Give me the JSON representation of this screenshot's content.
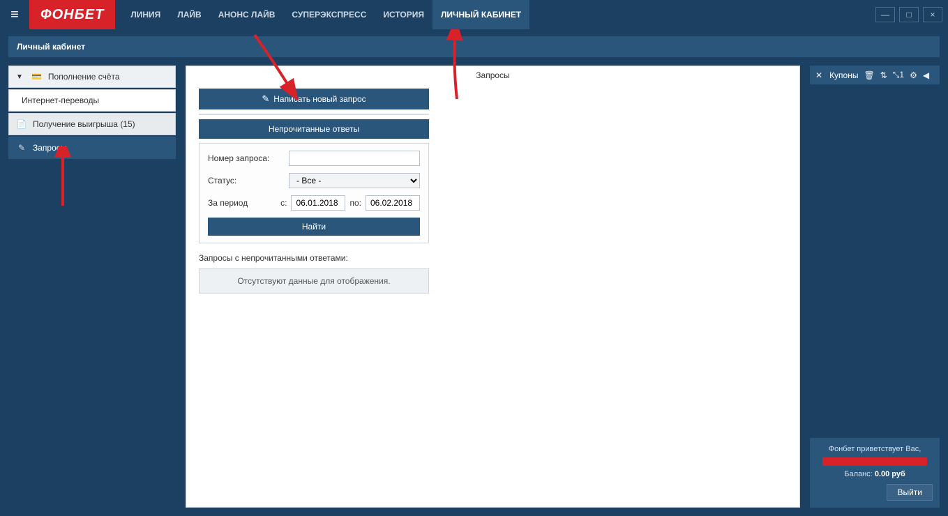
{
  "brand": "ФОНБЕТ",
  "nav": {
    "items": [
      {
        "label": "ЛИНИЯ"
      },
      {
        "label": "ЛАЙВ"
      },
      {
        "label": "АНОНС ЛАЙВ"
      },
      {
        "label": "СУПЕРЭКСПРЕСС"
      },
      {
        "label": "ИСТОРИЯ"
      },
      {
        "label": "ЛИЧНЫЙ КАБИНЕТ"
      }
    ],
    "active_index": 5
  },
  "window_controls": {
    "minimize": "—",
    "maximize": "□",
    "close": "×"
  },
  "section_title": "Личный кабинет",
  "sidebar": {
    "items": [
      {
        "label": "Пополнение счёта",
        "icon": "card-icon",
        "type": "header"
      },
      {
        "label": "Интернет-переводы",
        "icon": "",
        "type": "sub"
      },
      {
        "label": "Получение выигрыша (15)",
        "icon": "payout-icon",
        "type": "item"
      },
      {
        "label": "Запросы",
        "icon": "request-icon",
        "type": "active"
      }
    ]
  },
  "main": {
    "page_title": "Запросы",
    "new_request_btn": "Написать новый запрос",
    "unread_header": "Непрочитанные ответы",
    "filters": {
      "request_no_label": "Номер запроса:",
      "request_no_value": "",
      "status_label": "Статус:",
      "status_value": "- Все -",
      "period_label": "За период",
      "from_prefix": "с:",
      "from_value": "06.01.2018",
      "to_prefix": "по:",
      "to_value": "06.02.2018",
      "find_btn": "Найти"
    },
    "unread_caption": "Запросы с непрочитанными ответами:",
    "empty_text": "Отсутствуют данные для отображения."
  },
  "right": {
    "coupons_label": "Купоны",
    "count_badge": "1",
    "greeting": "Фонбет приветствует Вас,",
    "balance_label": "Баланс:",
    "balance_value": "0.00 руб",
    "logout": "Выйти"
  }
}
